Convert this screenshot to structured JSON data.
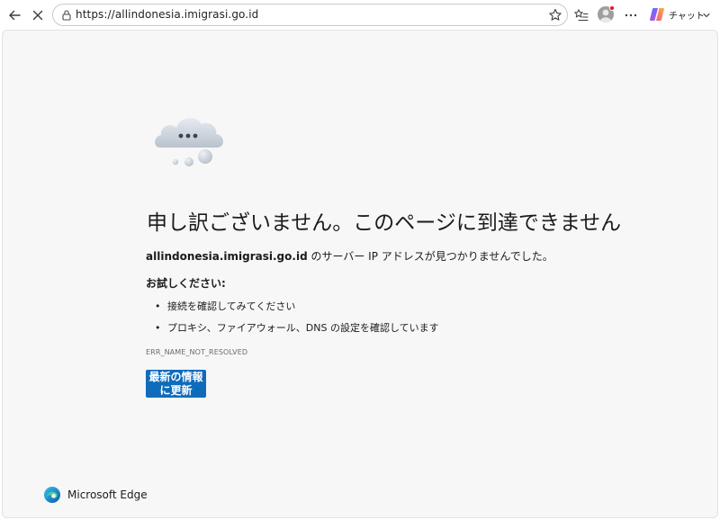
{
  "browser": {
    "url": "https://allindonesia.imigrasi.go.id",
    "chat_label": "チャット",
    "icons": [
      "back-arrow-icon",
      "stop-loading-icon",
      "lock-icon",
      "favorite-star-icon",
      "favorites-list-icon",
      "profile-avatar-icon",
      "more-icon",
      "copilot-icon",
      "chevron-down-icon"
    ]
  },
  "error_page": {
    "headline": "申し訳ございません。このページに到達できません",
    "host": "allindonesia.imigrasi.go.id",
    "host_suffix": " のサーバー IP アドレスが見つかりませんでした。",
    "try_label": "お試しください:",
    "suggestions": [
      "接続を確認してみてください",
      "プロキシ、ファイアウォール、DNS の設定を確認しています"
    ],
    "bullet": "•",
    "error_code": "ERR_NAME_NOT_RESOLVED",
    "refresh_label": "最新の情報に更新"
  },
  "brand": {
    "name": "Microsoft Edge"
  },
  "colors": {
    "accent": "#0f6cbd",
    "page_bg": "#f7f7f7"
  }
}
